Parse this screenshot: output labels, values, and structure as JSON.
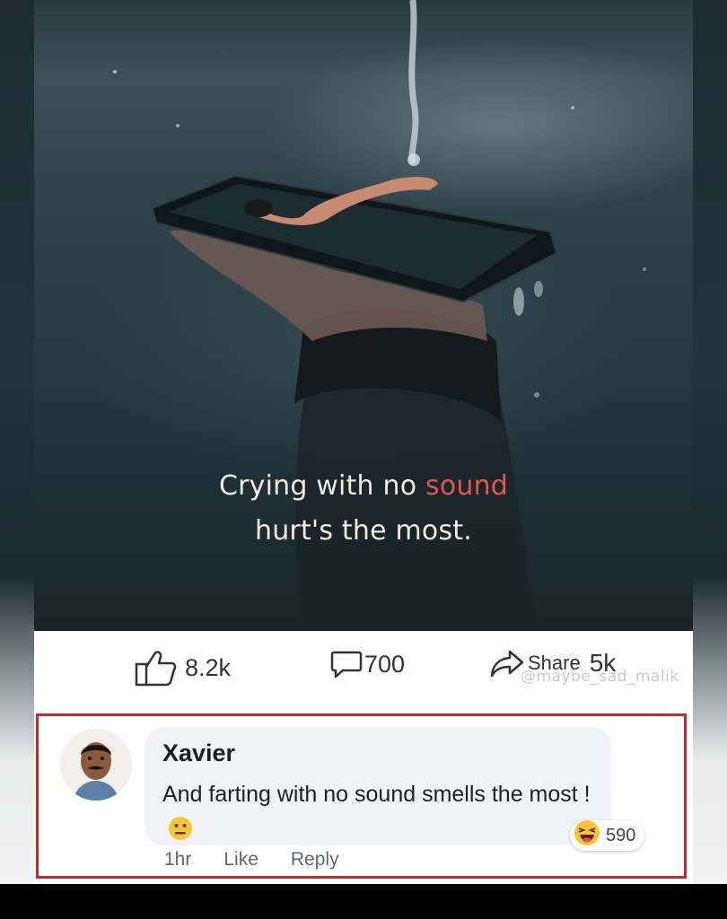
{
  "post": {
    "quote_line1_a": "Crying with no ",
    "quote_line1_b": "sound",
    "quote_line2": "hurt's the most.",
    "like_count": "8.2k",
    "comment_count": "700",
    "share_label": "Share",
    "share_count": "5k",
    "watermark": "@maybe_sad_malik"
  },
  "comment": {
    "author": "Xavier",
    "text": "And farting with no sound smells the most !",
    "time": "1hr",
    "like_label": "Like",
    "reply_label": "Reply",
    "reaction_icon": "laughing-emoji-icon",
    "reaction_count": "590",
    "inline_emoji": "neutral-face-emoji-icon"
  },
  "colors": {
    "highlight_border": "#c62a2f",
    "quote_accent": "#e0584c"
  }
}
